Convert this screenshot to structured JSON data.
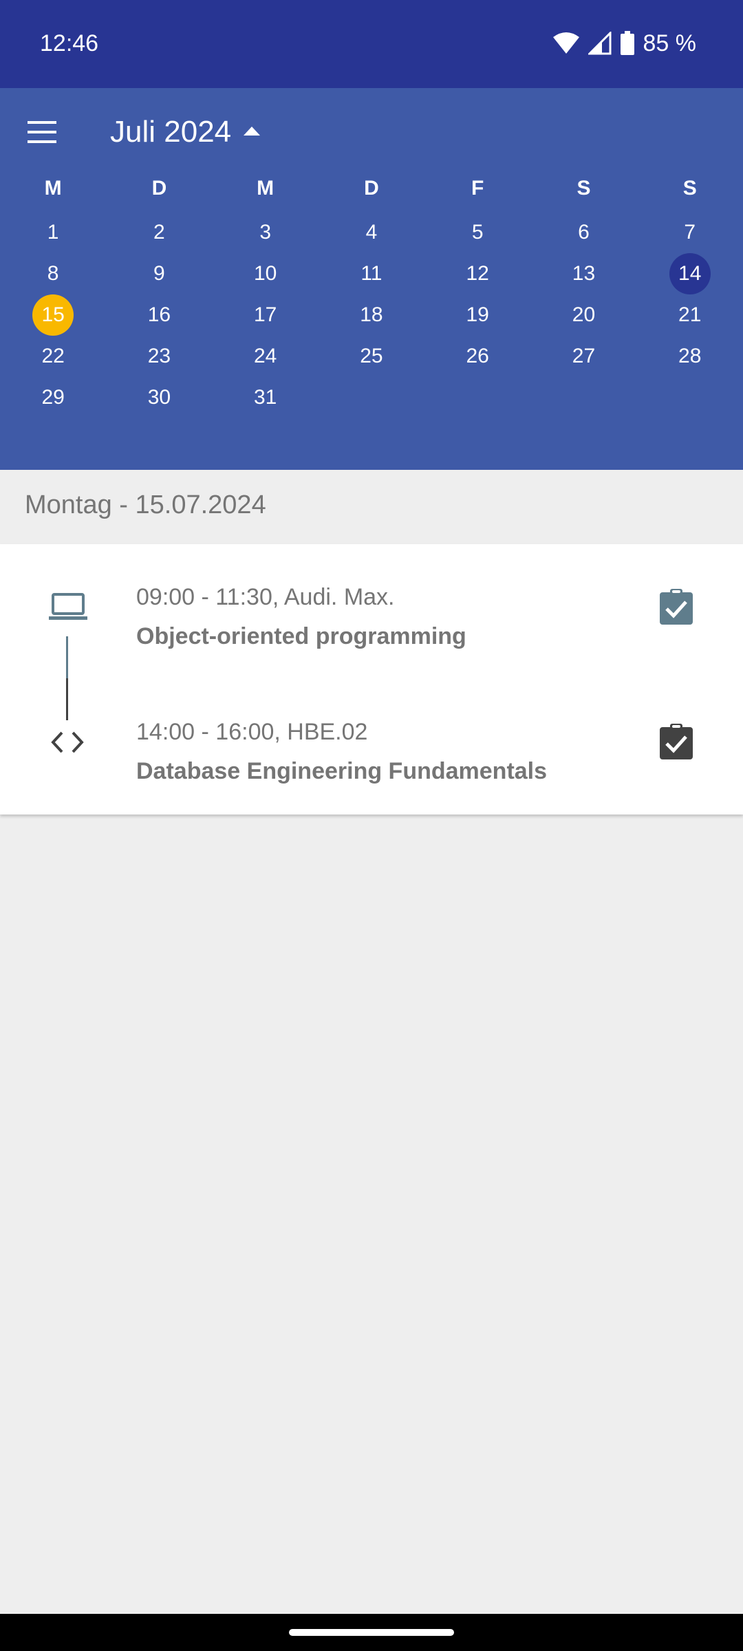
{
  "status_bar": {
    "time": "12:46",
    "battery": "85 %",
    "icons": [
      "wifi-icon",
      "cell-signal-icon",
      "battery-icon"
    ]
  },
  "calendar": {
    "month_title": "Juli 2024",
    "weekdays": [
      "M",
      "D",
      "M",
      "D",
      "F",
      "S",
      "S"
    ],
    "weeks": [
      [
        "1",
        "2",
        "3",
        "4",
        "5",
        "6",
        "7"
      ],
      [
        "8",
        "9",
        "10",
        "11",
        "12",
        "13",
        "14"
      ],
      [
        "15",
        "16",
        "17",
        "18",
        "19",
        "20",
        "21"
      ],
      [
        "22",
        "23",
        "24",
        "25",
        "26",
        "27",
        "28"
      ],
      [
        "29",
        "30",
        "31",
        "",
        "",
        "",
        ""
      ]
    ],
    "selected_day": "14",
    "today": "15",
    "colors": {
      "header_bg": "#3f5aa7",
      "status_bg": "#283593",
      "selected": "#283593",
      "today": "#f9b800"
    }
  },
  "day_header": "Montag - 15.07.2024",
  "events": [
    {
      "time_location": "09:00 - 11:30, Audi. Max.",
      "title": "Object-oriented programming",
      "icon": "laptop-icon",
      "action_icon": "clipboard-check-icon",
      "color": "#5f7d8c"
    },
    {
      "time_location": "14:00 - 16:00, HBE.02",
      "title": "Database Engineering Fundamentals",
      "icon": "code-icon",
      "action_icon": "clipboard-check-icon",
      "color": "#424242"
    }
  ]
}
